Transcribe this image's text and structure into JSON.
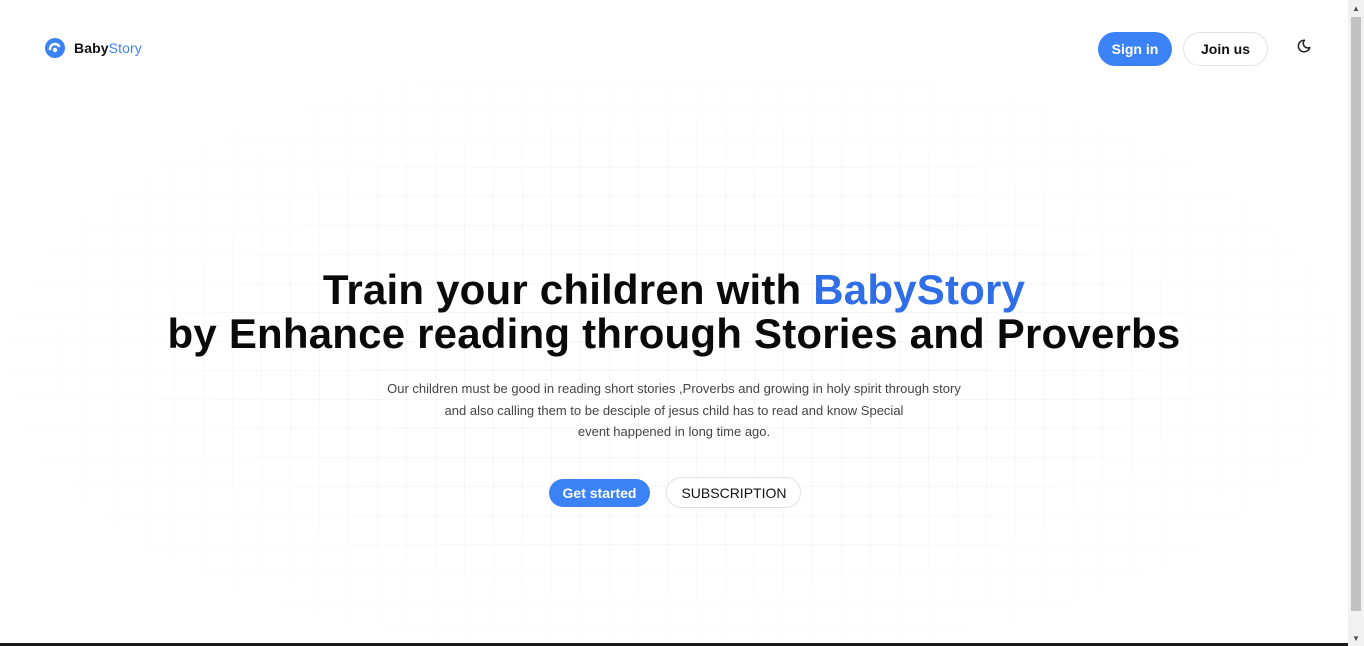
{
  "brand": {
    "name_part1": "Baby",
    "name_part2": "Story",
    "accent_color": "#3b82f6",
    "icon": "babystory-logo-icon"
  },
  "nav": {
    "sign_in_label": "Sign in",
    "join_label": "Join us",
    "theme_toggle_icon": "moon-icon"
  },
  "hero": {
    "title_line1_prefix": "Train your children with ",
    "title_line1_accent": "BabyStory",
    "title_line2": "by Enhance reading through Stories and Proverbs",
    "description_lines": [
      "Our children must be good in reading short stories ,Proverbs and growing in holy spirit through story",
      "and also calling them to be desciple of jesus child has to read and know Special",
      "event happened in long time ago."
    ],
    "get_started_label": "Get started",
    "subscription_label": "SUBSCRIPTION"
  }
}
